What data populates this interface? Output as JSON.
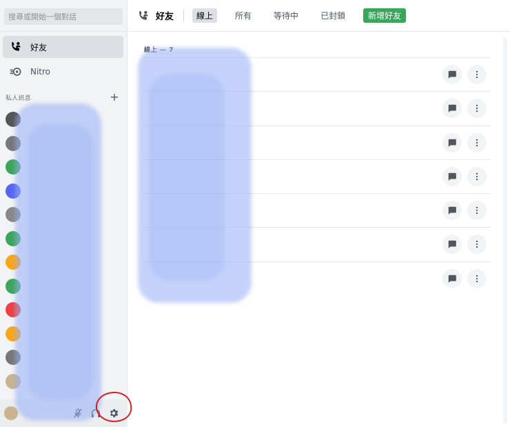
{
  "sidebar": {
    "search": {
      "placeholder": "搜尋或開始一個對話"
    },
    "items": [
      {
        "label": "好友",
        "icon": "friends-icon"
      },
      {
        "label": "Nitro",
        "icon": "nitro-icon"
      }
    ],
    "dm_header": "私人訊息",
    "dm_add_icon": "plus-icon",
    "dm_avatar_colors": [
      "#555555",
      "#777777",
      "#3ba55c",
      "#5865f2",
      "#888888",
      "#3ba55c",
      "#faa61a",
      "#3ba55c",
      "#ed4245",
      "#faa61a",
      "#777777",
      "#c9b48f"
    ],
    "user_controls": [
      "mute-icon",
      "headset-icon",
      "gear-icon"
    ]
  },
  "topbar": {
    "title": "好友",
    "tabs": [
      {
        "label": "線上",
        "active": true
      },
      {
        "label": "所有"
      },
      {
        "label": "等待中"
      },
      {
        "label": "已封鎖"
      }
    ],
    "add_friend": "新增好友"
  },
  "main": {
    "online_label": "線上 — 7",
    "friend_count": 7
  },
  "colors": {
    "accent_green": "#3ba55c",
    "sidebar_bg": "#f2f3f5",
    "annotation_red": "#d42020"
  }
}
